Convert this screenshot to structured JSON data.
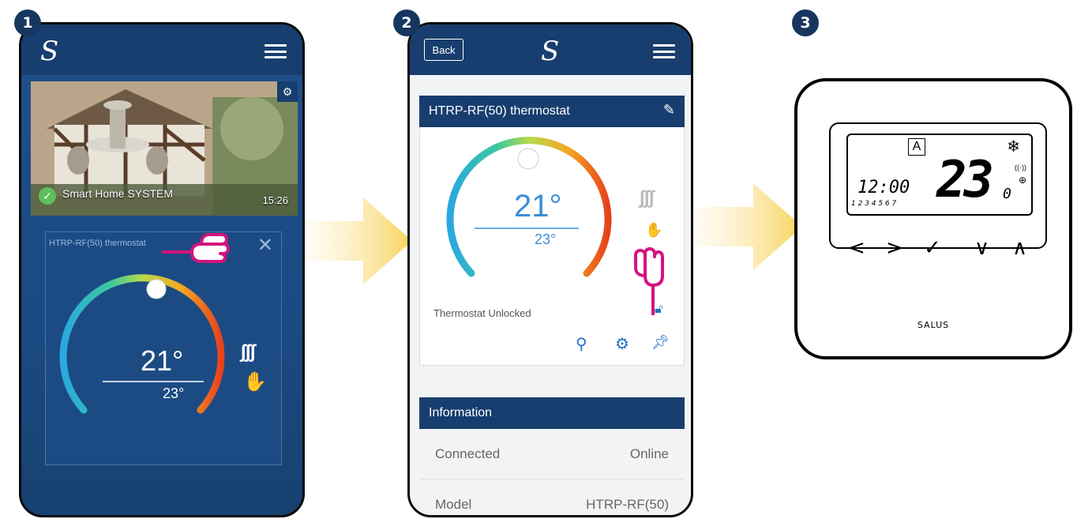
{
  "steps": {
    "s1": "1",
    "s2": "2",
    "s3": "3"
  },
  "phone1": {
    "camera_caption": "Smart Home SYSTEM",
    "camera_time": "15:26",
    "card_title": "HTRP-RF(50) thermostat",
    "close_label": "✕",
    "setpoint": "21°",
    "current": "23°"
  },
  "phone2": {
    "back_label": "Back",
    "panel_title": "HTRP-RF(50) thermostat",
    "setpoint": "21°",
    "current": "23°",
    "status": "Thermostat Unlocked",
    "info_title": "Information",
    "rows": [
      {
        "key": "Connected",
        "value": "Online"
      },
      {
        "key": "Model",
        "value": "HTRP-RF(50)"
      }
    ]
  },
  "device": {
    "mode_letter": "A",
    "time": "12:00",
    "days": "1 2 3 4 5 6 7",
    "temp": "23",
    "temp_decimal": "0",
    "brand": "SALUS",
    "keys": [
      "<",
      ">",
      "✓",
      "∨",
      "∧"
    ]
  },
  "colors": {
    "app_blue": "#173e6e",
    "arrow_yellow": "#f8d35a",
    "pointer_magenta": "#d3147f"
  },
  "icons": [
    "logo-icon",
    "menu-icon",
    "gear-icon",
    "check-icon",
    "heat-icon",
    "hand-icon",
    "pencil-icon",
    "lock-icon",
    "search-icon",
    "pin-icon",
    "snowflake-icon",
    "antenna-icon",
    "globe-icon"
  ]
}
